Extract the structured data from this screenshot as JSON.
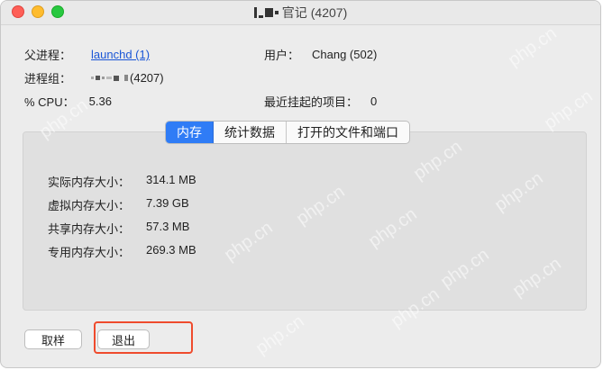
{
  "window": {
    "title_suffix": "(4207)",
    "title_mid": "官记"
  },
  "info": {
    "parent_label": "父进程：",
    "parent_value": "launchd (1)",
    "user_label": "用户：",
    "user_value": "Chang (502)",
    "group_label": "进程组：",
    "group_value_suffix": "(4207)",
    "cpu_label": "% CPU：",
    "cpu_value": "5.36",
    "recent_label": "最近挂起的项目：",
    "recent_value": "0"
  },
  "tabs": {
    "memory": "内存",
    "stats": "统计数据",
    "files": "打开的文件和端口"
  },
  "memory": {
    "real_label": "实际内存大小：",
    "real_value": "314.1 MB",
    "virtual_label": "虚拟内存大小：",
    "virtual_value": "7.39 GB",
    "shared_label": "共享内存大小：",
    "shared_value": "57.3 MB",
    "private_label": "专用内存大小：",
    "private_value": "269.3 MB"
  },
  "buttons": {
    "sample": "取样",
    "quit": "退出"
  },
  "watermark": "php.cn"
}
